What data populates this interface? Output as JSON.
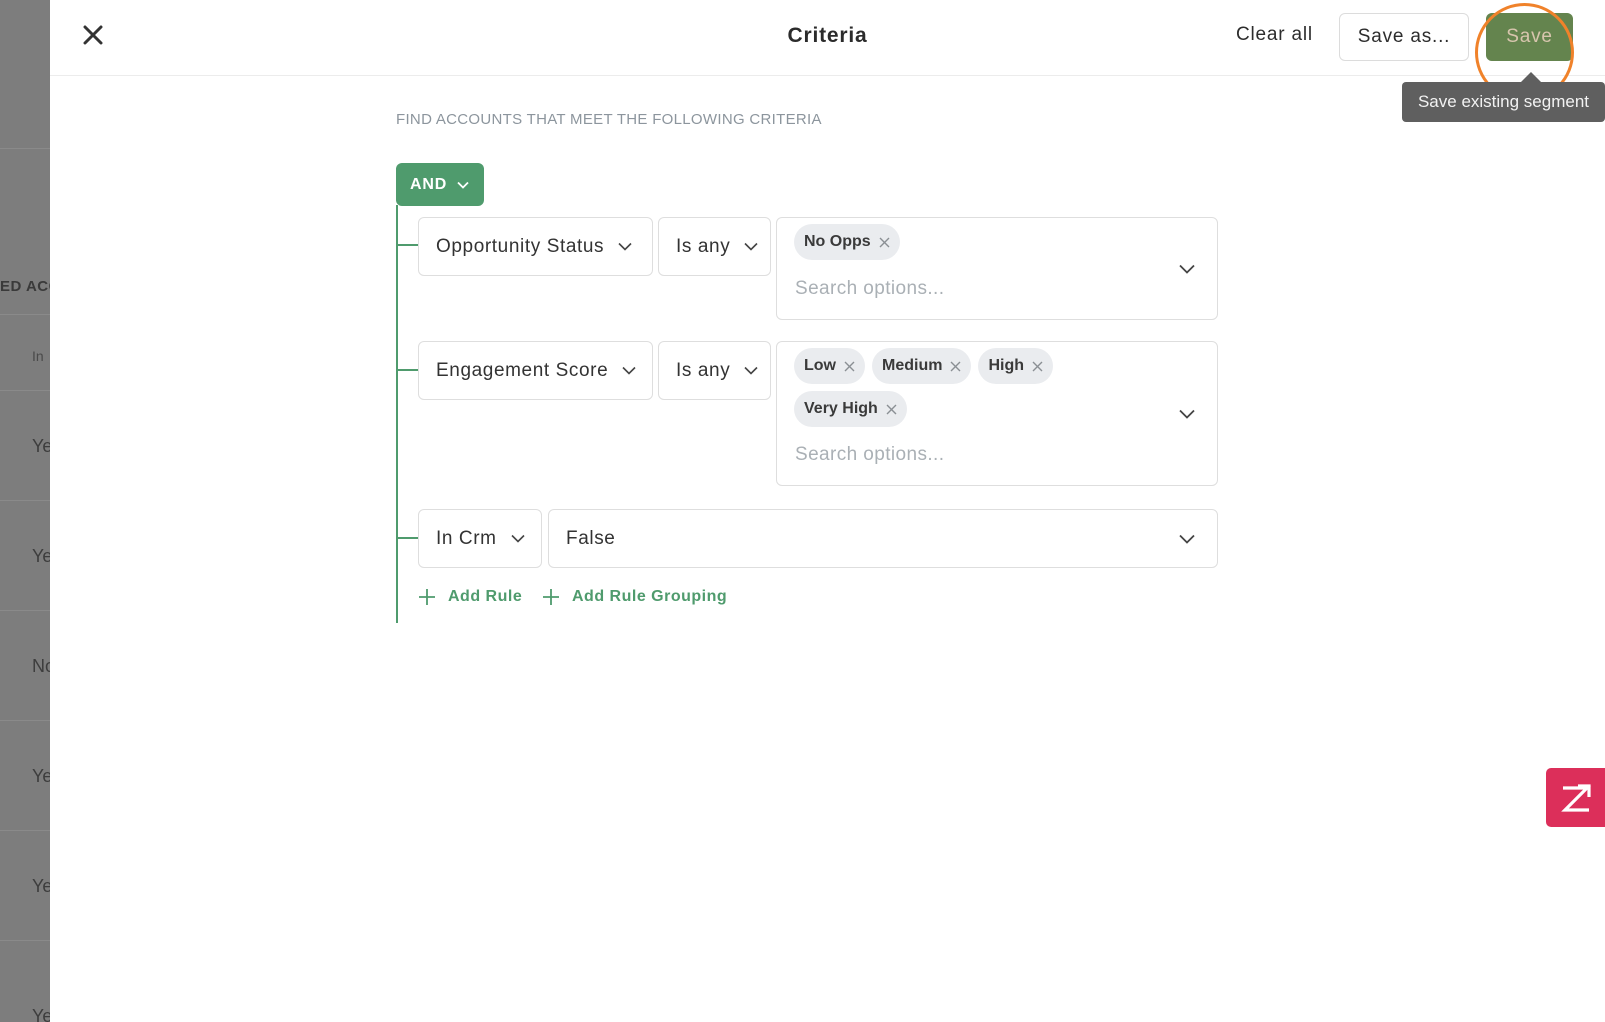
{
  "background": {
    "header_fragment": "ED ACC",
    "subheader_fragment": "In",
    "row_fragments": [
      "Ye",
      "Ye",
      "No",
      "Ye",
      "Ye",
      "Ye"
    ]
  },
  "header": {
    "title": "Criteria",
    "clear_all_label": "Clear all",
    "save_as_label": "Save as...",
    "save_label": "Save",
    "save_tooltip": "Save existing segment"
  },
  "criteria": {
    "section_label": "FIND ACCOUNTS THAT MEET THE FOLLOWING CRITERIA",
    "operator": "AND",
    "rules": [
      {
        "field": "Opportunity Status",
        "operator": "Is any",
        "chips": [
          "No Opps"
        ],
        "search_placeholder": "Search options..."
      },
      {
        "field": "Engagement Score",
        "operator": "Is any",
        "chips": [
          "Low",
          "Medium",
          "High",
          "Very High"
        ],
        "search_placeholder": "Search options..."
      },
      {
        "field": "In Crm",
        "value": "False"
      }
    ],
    "add_rule_label": "Add Rule",
    "add_rule_grouping_label": "Add Rule Grouping"
  },
  "colors": {
    "accent_green": "#4f9b6d",
    "highlight_orange": "#f0822a",
    "zendesk_pink": "#dc2f5a"
  },
  "icons": {
    "close": "close-icon",
    "chevron": "chevron-down-icon",
    "chip_remove": "chip-remove-icon",
    "add": "plus-icon",
    "widget": "zendesk-icon"
  }
}
